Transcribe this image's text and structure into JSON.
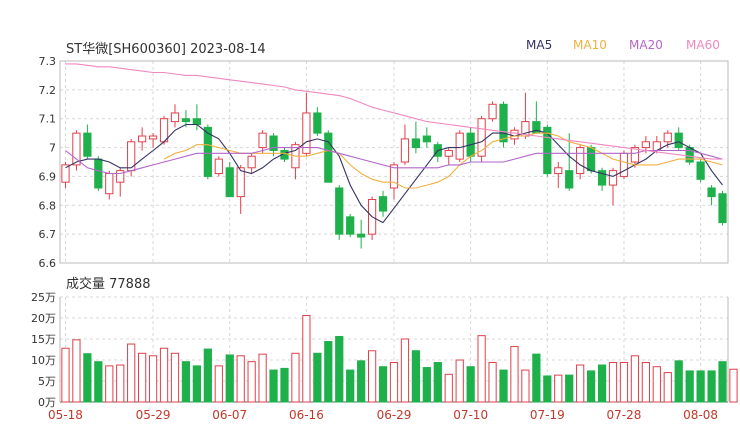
{
  "header": {
    "title": "ST华微[SH600360] 2023-08-14",
    "legend": [
      {
        "label": "MA5",
        "color": "#333366"
      },
      {
        "label": "MA10",
        "color": "#f0b040"
      },
      {
        "label": "MA20",
        "color": "#b266cc"
      },
      {
        "label": "MA60",
        "color": "#f088c0"
      }
    ]
  },
  "volume_panel": {
    "title": "成交量 77888"
  },
  "colors": {
    "up": "#e0404a",
    "down": "#1eb04a",
    "grid": "#d8d8d8",
    "axis_text": "#333333",
    "date_text": "#c0392b"
  },
  "chart_data": [
    {
      "type": "candlestick",
      "title": "ST华微[SH600360] 2023-08-14",
      "ylim": [
        6.6,
        7.3
      ],
      "y_ticks": [
        "7.3",
        "7.2",
        "7.1",
        "7",
        "6.9",
        "6.8",
        "6.7",
        "6.6"
      ],
      "x_ticks": [
        "05-18",
        "05-29",
        "06-07",
        "06-16",
        "06-29",
        "07-10",
        "07-19",
        "07-28",
        "08-08"
      ],
      "x_tick_index": [
        0,
        8,
        15,
        22,
        30,
        37,
        44,
        51,
        58
      ],
      "candles": [
        {
          "o": 6.88,
          "c": 6.94,
          "h": 6.95,
          "l": 6.86
        },
        {
          "o": 6.94,
          "c": 7.05,
          "h": 7.06,
          "l": 6.92
        },
        {
          "o": 7.05,
          "c": 6.97,
          "h": 7.08,
          "l": 6.96
        },
        {
          "o": 6.96,
          "c": 6.86,
          "h": 6.97,
          "l": 6.85
        },
        {
          "o": 6.84,
          "c": 6.91,
          "h": 6.92,
          "l": 6.82
        },
        {
          "o": 6.88,
          "c": 6.92,
          "h": 6.93,
          "l": 6.83
        },
        {
          "o": 6.92,
          "c": 7.02,
          "h": 7.03,
          "l": 6.9
        },
        {
          "o": 7.02,
          "c": 7.04,
          "h": 7.07,
          "l": 6.99
        },
        {
          "o": 7.03,
          "c": 7.04,
          "h": 7.05,
          "l": 7.0
        },
        {
          "o": 7.02,
          "c": 7.1,
          "h": 7.11,
          "l": 7.01
        },
        {
          "o": 7.09,
          "c": 7.12,
          "h": 7.15,
          "l": 7.07
        },
        {
          "o": 7.1,
          "c": 7.09,
          "h": 7.13,
          "l": 7.07
        },
        {
          "o": 7.1,
          "c": 7.08,
          "h": 7.15,
          "l": 7.06
        },
        {
          "o": 7.07,
          "c": 6.9,
          "h": 7.08,
          "l": 6.89
        },
        {
          "o": 6.91,
          "c": 6.96,
          "h": 6.97,
          "l": 6.9
        },
        {
          "o": 6.93,
          "c": 6.83,
          "h": 6.95,
          "l": 6.83
        },
        {
          "o": 6.83,
          "c": 6.93,
          "h": 6.94,
          "l": 6.77
        },
        {
          "o": 6.93,
          "c": 6.97,
          "h": 6.98,
          "l": 6.91
        },
        {
          "o": 7.0,
          "c": 7.05,
          "h": 7.06,
          "l": 6.98
        },
        {
          "o": 7.04,
          "c": 6.99,
          "h": 7.05,
          "l": 6.97
        },
        {
          "o": 6.99,
          "c": 6.96,
          "h": 7.0,
          "l": 6.95
        },
        {
          "o": 6.93,
          "c": 7.01,
          "h": 7.02,
          "l": 6.89
        },
        {
          "o": 6.98,
          "c": 7.12,
          "h": 7.19,
          "l": 6.97
        },
        {
          "o": 7.12,
          "c": 7.05,
          "h": 7.14,
          "l": 7.04
        },
        {
          "o": 7.05,
          "c": 6.88,
          "h": 7.06,
          "l": 6.88
        },
        {
          "o": 6.86,
          "c": 6.7,
          "h": 6.87,
          "l": 6.68
        },
        {
          "o": 6.76,
          "c": 6.7,
          "h": 6.77,
          "l": 6.69
        },
        {
          "o": 6.7,
          "c": 6.69,
          "h": 6.75,
          "l": 6.65
        },
        {
          "o": 6.7,
          "c": 6.82,
          "h": 6.83,
          "l": 6.68
        },
        {
          "o": 6.83,
          "c": 6.78,
          "h": 6.85,
          "l": 6.76
        },
        {
          "o": 6.86,
          "c": 6.94,
          "h": 6.95,
          "l": 6.82
        },
        {
          "o": 6.95,
          "c": 7.03,
          "h": 7.08,
          "l": 6.94
        },
        {
          "o": 7.03,
          "c": 7.0,
          "h": 7.09,
          "l": 6.98
        },
        {
          "o": 7.04,
          "c": 7.02,
          "h": 7.07,
          "l": 7.0
        },
        {
          "o": 7.01,
          "c": 6.97,
          "h": 7.02,
          "l": 6.95
        },
        {
          "o": 6.97,
          "c": 6.99,
          "h": 7.0,
          "l": 6.94
        },
        {
          "o": 6.96,
          "c": 7.05,
          "h": 7.06,
          "l": 6.95
        },
        {
          "o": 7.05,
          "c": 6.97,
          "h": 7.07,
          "l": 6.95
        },
        {
          "o": 6.97,
          "c": 7.1,
          "h": 7.11,
          "l": 6.95
        },
        {
          "o": 7.1,
          "c": 7.15,
          "h": 7.16,
          "l": 7.09
        },
        {
          "o": 7.15,
          "c": 7.02,
          "h": 7.16,
          "l": 7.0
        },
        {
          "o": 7.03,
          "c": 7.06,
          "h": 7.07,
          "l": 7.01
        },
        {
          "o": 7.04,
          "c": 7.09,
          "h": 7.19,
          "l": 7.03
        },
        {
          "o": 7.09,
          "c": 7.05,
          "h": 7.16,
          "l": 7.05
        },
        {
          "o": 7.07,
          "c": 6.91,
          "h": 7.08,
          "l": 6.9
        },
        {
          "o": 6.91,
          "c": 6.93,
          "h": 6.95,
          "l": 6.86
        },
        {
          "o": 6.92,
          "c": 6.86,
          "h": 7.05,
          "l": 6.85
        },
        {
          "o": 6.91,
          "c": 7.0,
          "h": 7.01,
          "l": 6.89
        },
        {
          "o": 7.0,
          "c": 6.92,
          "h": 7.01,
          "l": 6.91
        },
        {
          "o": 6.92,
          "c": 6.87,
          "h": 6.93,
          "l": 6.85
        },
        {
          "o": 6.87,
          "c": 6.92,
          "h": 6.93,
          "l": 6.8
        },
        {
          "o": 6.9,
          "c": 6.98,
          "h": 6.99,
          "l": 6.89
        },
        {
          "o": 6.95,
          "c": 7.0,
          "h": 7.01,
          "l": 6.93
        },
        {
          "o": 7.0,
          "c": 7.02,
          "h": 7.04,
          "l": 6.98
        },
        {
          "o": 6.99,
          "c": 7.02,
          "h": 7.04,
          "l": 6.98
        },
        {
          "o": 7.02,
          "c": 7.05,
          "h": 7.06,
          "l": 7.0
        },
        {
          "o": 7.05,
          "c": 7.0,
          "h": 7.07,
          "l": 6.99
        },
        {
          "o": 7.0,
          "c": 6.95,
          "h": 7.01,
          "l": 6.94
        },
        {
          "o": 6.95,
          "c": 6.89,
          "h": 6.96,
          "l": 6.88
        },
        {
          "o": 6.86,
          "c": 6.83,
          "h": 6.87,
          "l": 6.8
        },
        {
          "o": 6.84,
          "c": 6.74,
          "h": 6.85,
          "l": 6.73
        }
      ],
      "ma": {
        "MA5": [
          6.93,
          6.95,
          6.96,
          6.96,
          6.95,
          6.93,
          6.93,
          6.96,
          6.99,
          7.02,
          7.06,
          7.08,
          7.08,
          7.05,
          7.03,
          6.98,
          6.92,
          6.91,
          6.93,
          6.96,
          6.98,
          6.99,
          7.02,
          7.03,
          7.02,
          6.97,
          6.87,
          6.8,
          6.76,
          6.74,
          6.79,
          6.84,
          6.89,
          6.94,
          6.99,
          7.0,
          7.0,
          7.01,
          7.02,
          7.05,
          7.05,
          7.04,
          7.05,
          7.06,
          7.05,
          7.01,
          6.97,
          6.94,
          6.92,
          6.91,
          6.9,
          6.92,
          6.94,
          6.96,
          6.99,
          7.01,
          7.02,
          7.0,
          6.98,
          6.92,
          6.87
        ],
        "MA10": [
          null,
          null,
          null,
          null,
          null,
          null,
          null,
          null,
          null,
          6.96,
          6.98,
          6.99,
          7.01,
          7.01,
          7.0,
          6.99,
          6.98,
          6.98,
          6.98,
          6.98,
          6.98,
          6.97,
          6.97,
          6.98,
          6.99,
          6.98,
          6.94,
          6.91,
          6.89,
          6.88,
          6.88,
          6.86,
          6.86,
          6.87,
          6.88,
          6.9,
          6.94,
          6.97,
          6.99,
          7.02,
          7.03,
          7.04,
          7.04,
          7.05,
          7.05,
          7.04,
          7.02,
          7.01,
          7.0,
          6.98,
          6.96,
          6.95,
          6.94,
          6.94,
          6.94,
          6.95,
          6.96,
          6.96,
          6.96,
          6.95,
          6.94
        ],
        "MA20": [
          6.99,
          6.96,
          6.93,
          6.92,
          6.91,
          6.91,
          6.92,
          6.93,
          6.94,
          6.95,
          6.96,
          6.97,
          6.98,
          6.98,
          6.98,
          6.98,
          6.98,
          6.98,
          6.99,
          7.0,
          7.0,
          7.0,
          7.0,
          7.0,
          6.99,
          6.98,
          6.97,
          6.96,
          6.95,
          6.94,
          6.93,
          6.93,
          6.93,
          6.93,
          6.93,
          6.94,
          6.94,
          6.95,
          6.95,
          6.95,
          6.95,
          6.96,
          6.97,
          6.98,
          6.98,
          6.98,
          6.98,
          6.98,
          6.98,
          6.98,
          6.98,
          6.98,
          6.98,
          6.99,
          6.99,
          6.99,
          6.99,
          6.99,
          6.98,
          6.97,
          6.96
        ],
        "MA60": [
          7.29,
          7.29,
          7.285,
          7.28,
          7.28,
          7.275,
          7.27,
          7.265,
          7.26,
          7.26,
          7.255,
          7.25,
          7.25,
          7.245,
          7.24,
          7.235,
          7.23,
          7.225,
          7.22,
          7.215,
          7.21,
          7.2,
          7.195,
          7.19,
          7.185,
          7.18,
          7.17,
          7.155,
          7.14,
          7.13,
          7.12,
          7.11,
          7.1,
          7.09,
          7.085,
          7.08,
          7.075,
          7.07,
          7.065,
          7.06,
          7.055,
          7.05,
          7.045,
          7.04,
          7.035,
          7.03,
          7.025,
          7.02,
          7.015,
          7.01,
          7.005,
          7.0,
          6.995,
          6.99,
          6.985,
          6.98,
          6.975,
          6.97,
          6.965,
          6.96,
          6.96
        ]
      }
    },
    {
      "type": "bar",
      "title": "成交量 77888",
      "ylim": [
        0,
        25
      ],
      "y_ticks": [
        "25万",
        "20万",
        "15万",
        "10万",
        "5万",
        "0万"
      ],
      "values": [
        12.8,
        14.8,
        11.5,
        9.6,
        8.6,
        8.8,
        13.8,
        11.6,
        11.0,
        12.8,
        11.6,
        9.6,
        8.6,
        12.6,
        8.6,
        11.2,
        11.0,
        9.6,
        11.4,
        7.6,
        8.0,
        11.6,
        20.6,
        11.6,
        14.4,
        15.6,
        7.6,
        9.8,
        12.2,
        8.4,
        9.4,
        15.0,
        12.2,
        8.2,
        9.4,
        6.6,
        10.0,
        8.4,
        15.8,
        9.4,
        7.6,
        13.2,
        7.6,
        11.4,
        6.2,
        6.4,
        6.4,
        8.8,
        7.4,
        8.8,
        9.4,
        9.4,
        11.0,
        9.4,
        8.4,
        7.0,
        9.8,
        7.4,
        7.4,
        7.4,
        9.6,
        7.8
      ]
    }
  ]
}
